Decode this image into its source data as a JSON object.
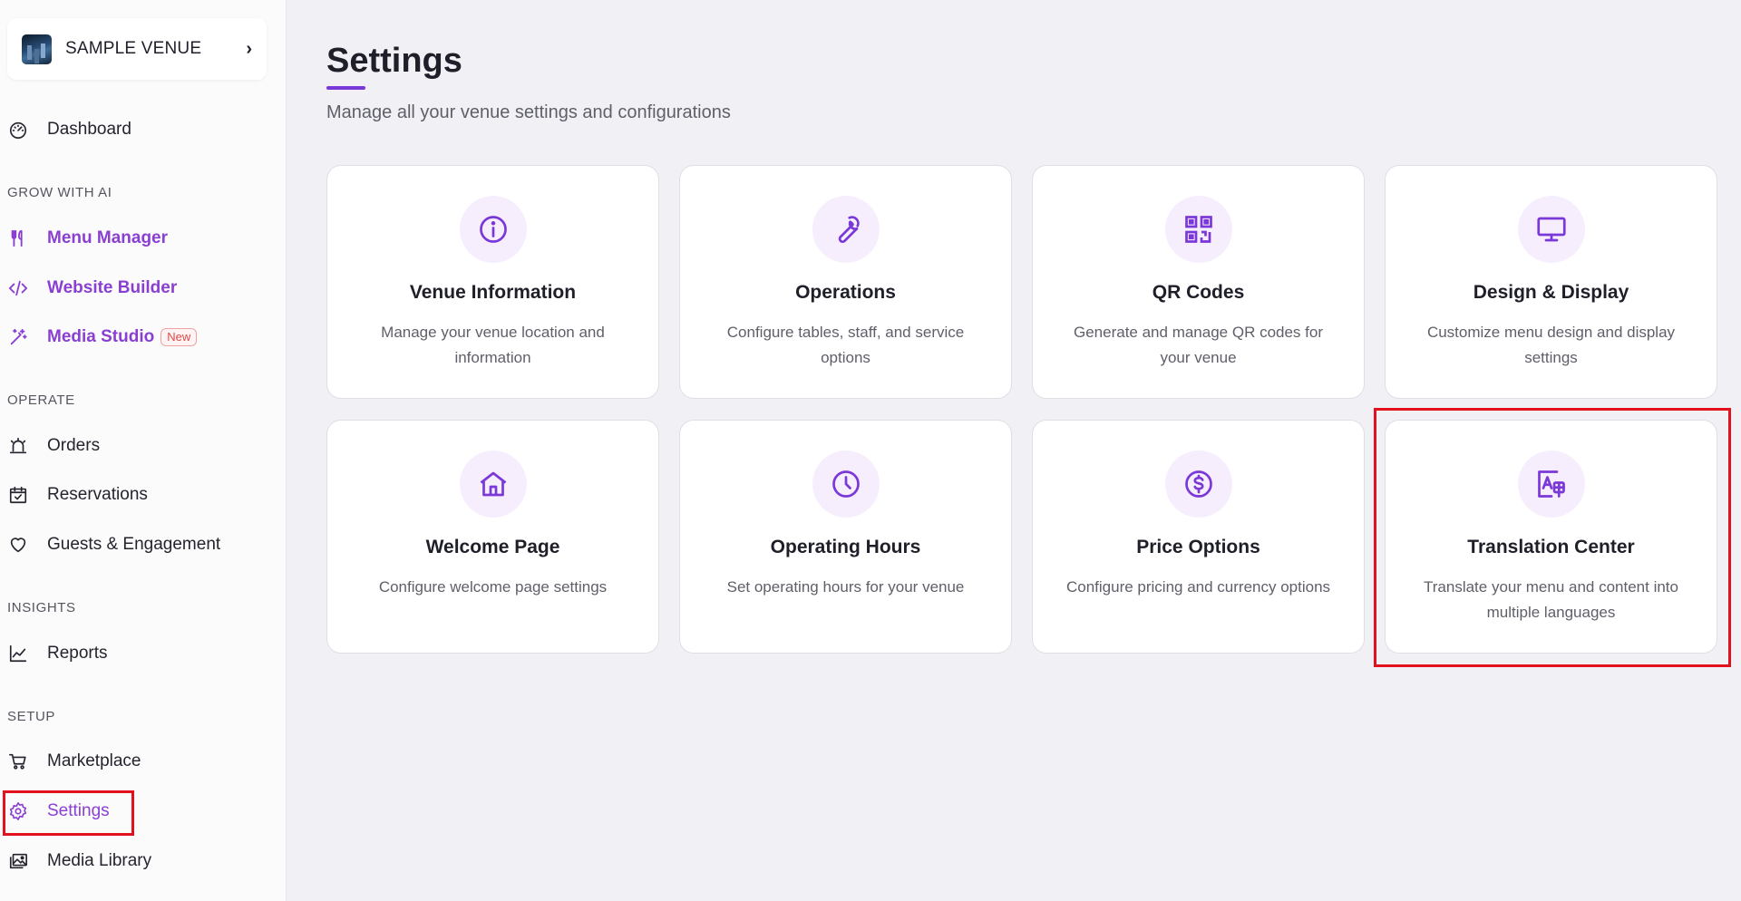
{
  "sidebar": {
    "venue": {
      "name": "SAMPLE VENUE",
      "chevron": "›"
    },
    "dashboard": {
      "label": "Dashboard",
      "icon": "speedometer-icon"
    },
    "sections": {
      "grow": "GROW WITH AI",
      "operate": "OPERATE",
      "insights": "INSIGHTS",
      "setup": "SETUP"
    },
    "grow_items": [
      {
        "label": "Menu Manager",
        "icon": "fork-knife-icon"
      },
      {
        "label": "Website Builder",
        "icon": "code-icon"
      },
      {
        "label": "Media Studio",
        "icon": "magic-wand-icon",
        "badge": "New"
      }
    ],
    "operate_items": [
      {
        "label": "Orders",
        "icon": "bell-alarm-icon"
      },
      {
        "label": "Reservations",
        "icon": "calendar-check-icon"
      },
      {
        "label": "Guests & Engagement",
        "icon": "heart-icon"
      }
    ],
    "insights_items": [
      {
        "label": "Reports",
        "icon": "line-chart-icon"
      }
    ],
    "setup_items": [
      {
        "label": "Marketplace",
        "icon": "cart-icon"
      },
      {
        "label": "Settings",
        "icon": "gear-icon",
        "active": true
      },
      {
        "label": "Media Library",
        "icon": "images-icon"
      }
    ]
  },
  "main": {
    "title": "Settings",
    "subtitle": "Manage all your venue settings and configurations",
    "cards": [
      {
        "title": "Venue Information",
        "desc": "Manage your venue location and information",
        "icon": "info-icon"
      },
      {
        "title": "Operations",
        "desc": "Configure tables, staff, and service options",
        "icon": "wrench-icon"
      },
      {
        "title": "QR Codes",
        "desc": "Generate and manage QR codes for your venue",
        "icon": "qr-code-icon"
      },
      {
        "title": "Design & Display",
        "desc": "Customize menu design and display settings",
        "icon": "monitor-icon"
      },
      {
        "title": "Welcome Page",
        "desc": "Configure welcome page settings",
        "icon": "home-icon"
      },
      {
        "title": "Operating Hours",
        "desc": "Set operating hours for your venue",
        "icon": "clock-icon"
      },
      {
        "title": "Price Options",
        "desc": "Configure pricing and currency options",
        "icon": "dollar-icon"
      },
      {
        "title": "Translation Center",
        "desc": "Translate your menu and content into multiple languages",
        "icon": "translate-icon"
      }
    ]
  },
  "colors": {
    "accent": "#7b38d8",
    "ai_label": "#8a3fd1",
    "highlight": "#e3101d",
    "icon_bg": "#f6eefd"
  }
}
